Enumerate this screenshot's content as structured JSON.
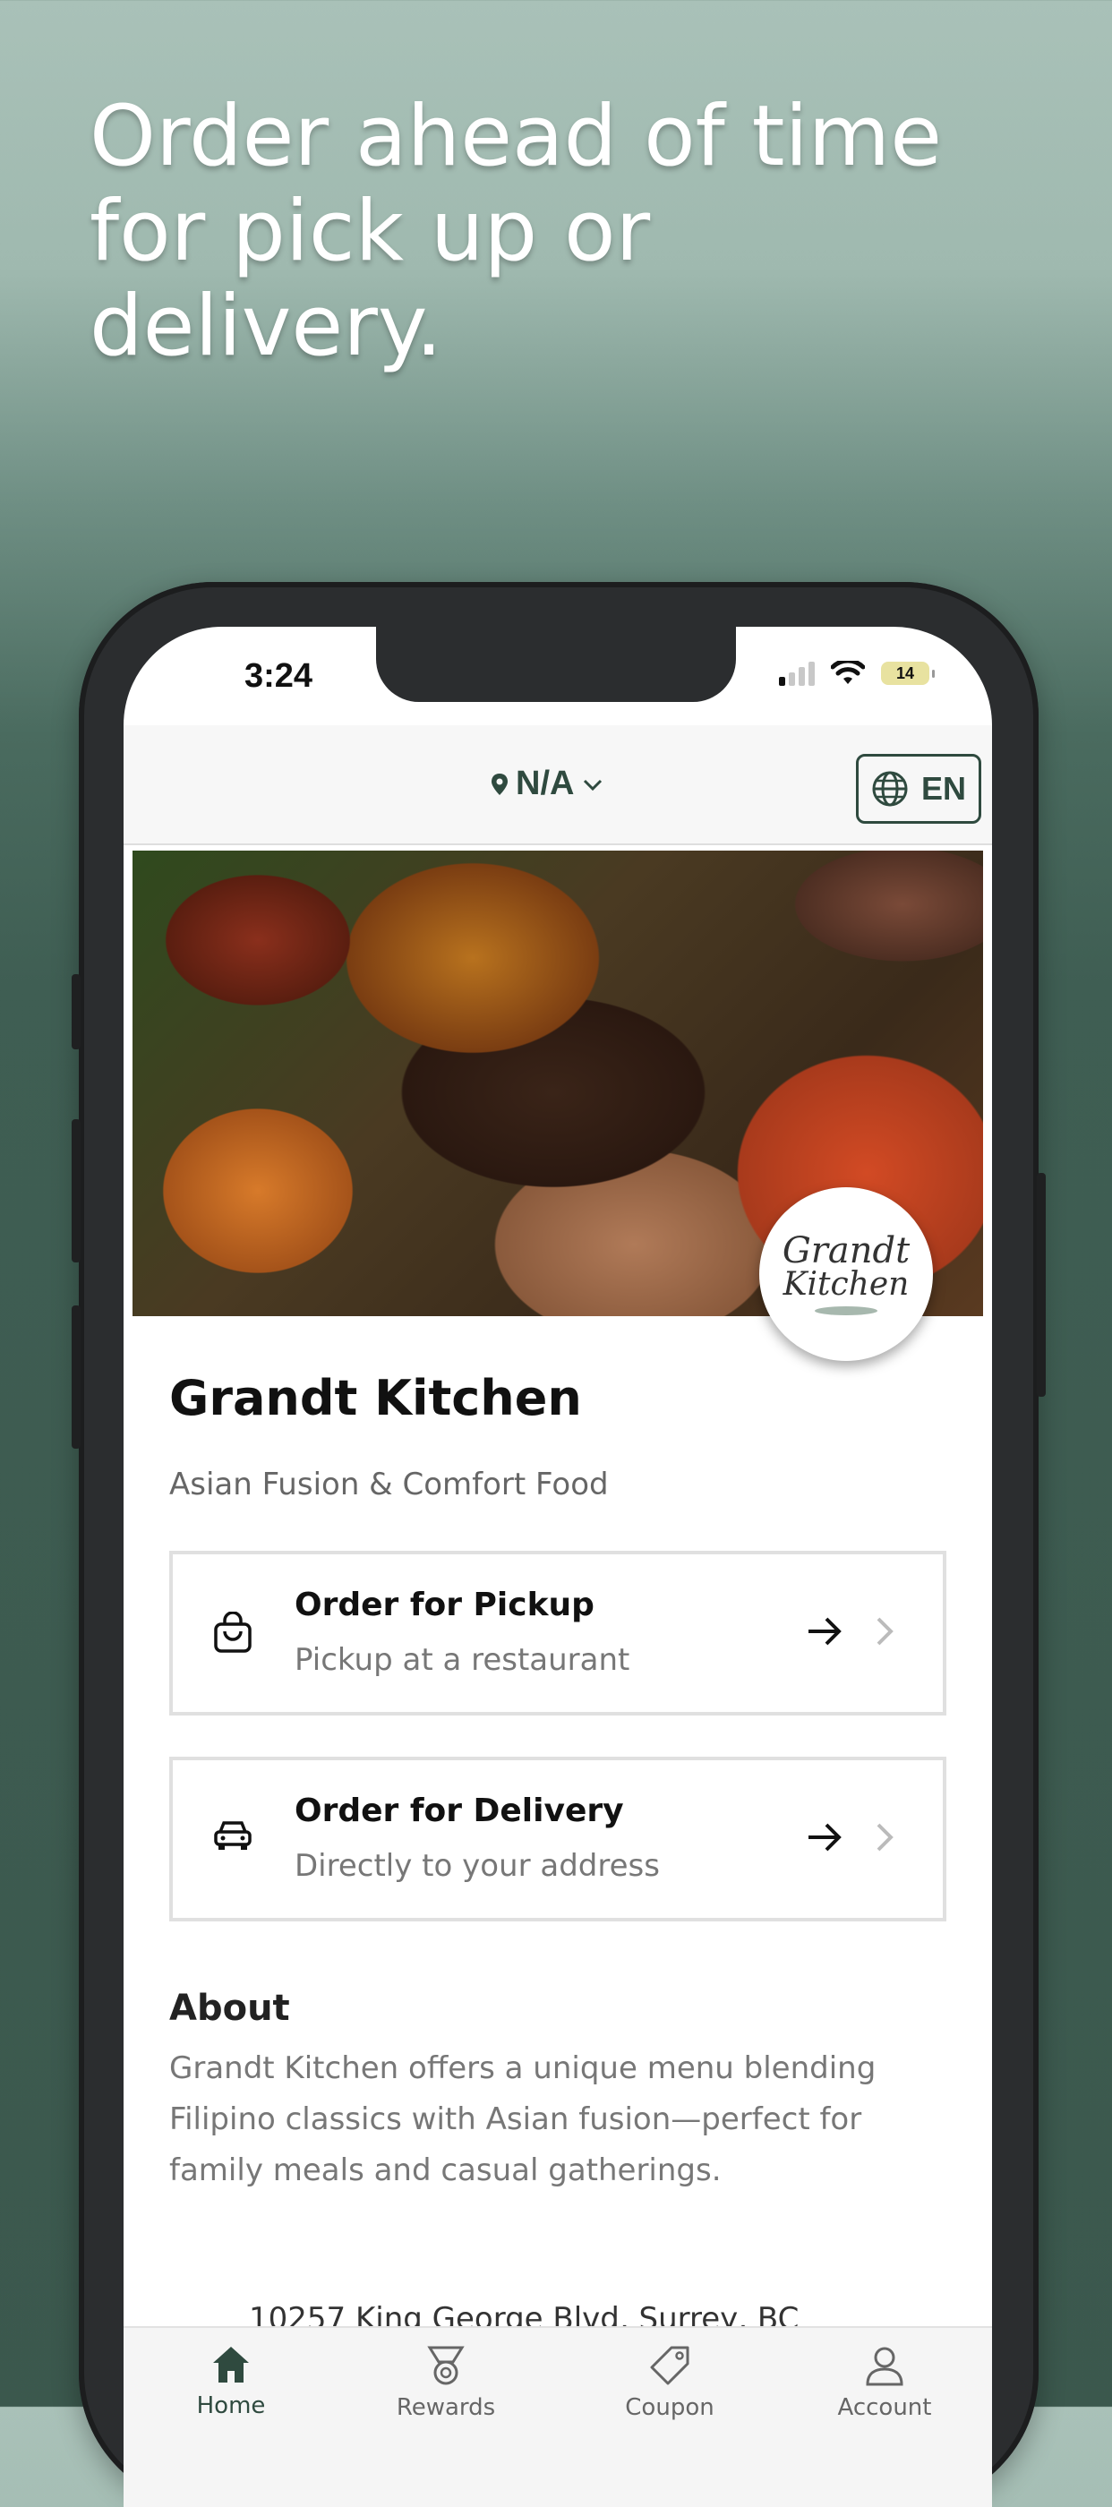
{
  "marketing": {
    "headline_line1": "Order ahead of time",
    "headline_line2": "for pick up or",
    "headline_line3": "delivery."
  },
  "status_bar": {
    "time": "3:24",
    "battery": "14"
  },
  "header": {
    "location": "N/A",
    "language": "EN"
  },
  "restaurant": {
    "logo_line1": "Grandt",
    "logo_line2": "Kitchen",
    "name": "Grandt Kitchen",
    "subtitle": "Asian Fusion & Comfort Food"
  },
  "options": [
    {
      "title": "Order for Pickup",
      "subtitle": "Pickup at a restaurant",
      "icon": "shopping-bag-icon"
    },
    {
      "title": "Order for Delivery",
      "subtitle": "Directly to your address",
      "icon": "car-icon"
    }
  ],
  "about": {
    "heading": "About",
    "text": "Grandt Kitchen offers a unique menu blending Filipino classics with Asian fusion—perfect for family meals and casual gatherings.",
    "address": "10257 King George Blvd, Surrey, BC"
  },
  "tabs": [
    {
      "label": "Home",
      "icon": "home-icon",
      "active": true
    },
    {
      "label": "Rewards",
      "icon": "medal-icon",
      "active": false
    },
    {
      "label": "Coupon",
      "icon": "tag-icon",
      "active": false
    },
    {
      "label": "Account",
      "icon": "user-icon",
      "active": false
    }
  ],
  "colors": {
    "accent": "#2f4a3f",
    "background_top": "#a9c1b8",
    "background_bottom": "#3b584d"
  }
}
